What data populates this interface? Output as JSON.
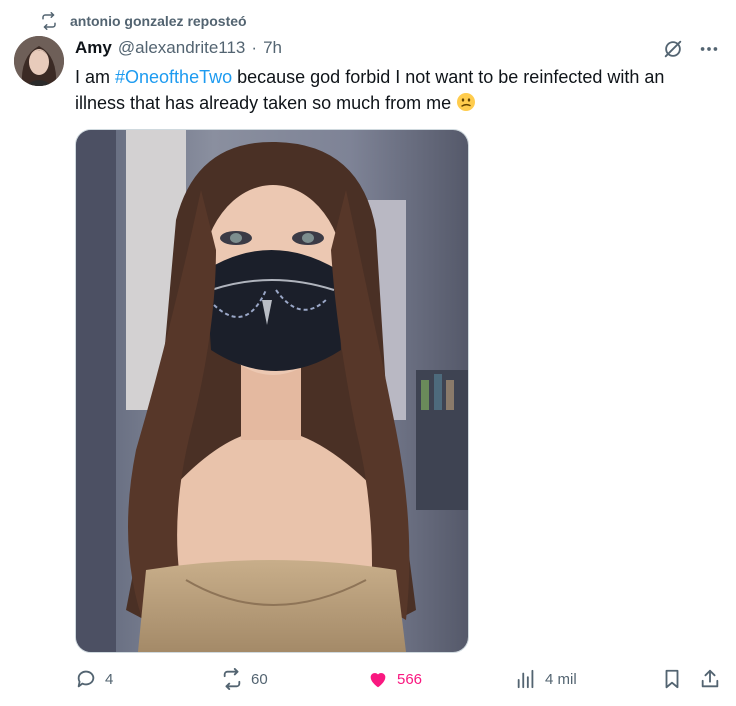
{
  "repost": {
    "text": "antonio gonzalez reposteó",
    "icon": "repost-icon"
  },
  "author": {
    "name": "Amy",
    "handle": "@alexandrite113",
    "separator": "·",
    "time": "7h"
  },
  "tweet": {
    "text_before": "I am ",
    "hashtag": "#OneoftheTwo",
    "text_after": " because god forbid I not want to be reinfected with an illness that has already taken so much from me",
    "emoji": "confused-face-emoji"
  },
  "stats": {
    "replies": "4",
    "reposts": "60",
    "likes": "566",
    "views": "4 mil"
  },
  "colors": {
    "accent": "#1d9bf0",
    "like": "#f91880",
    "muted": "#536471"
  }
}
